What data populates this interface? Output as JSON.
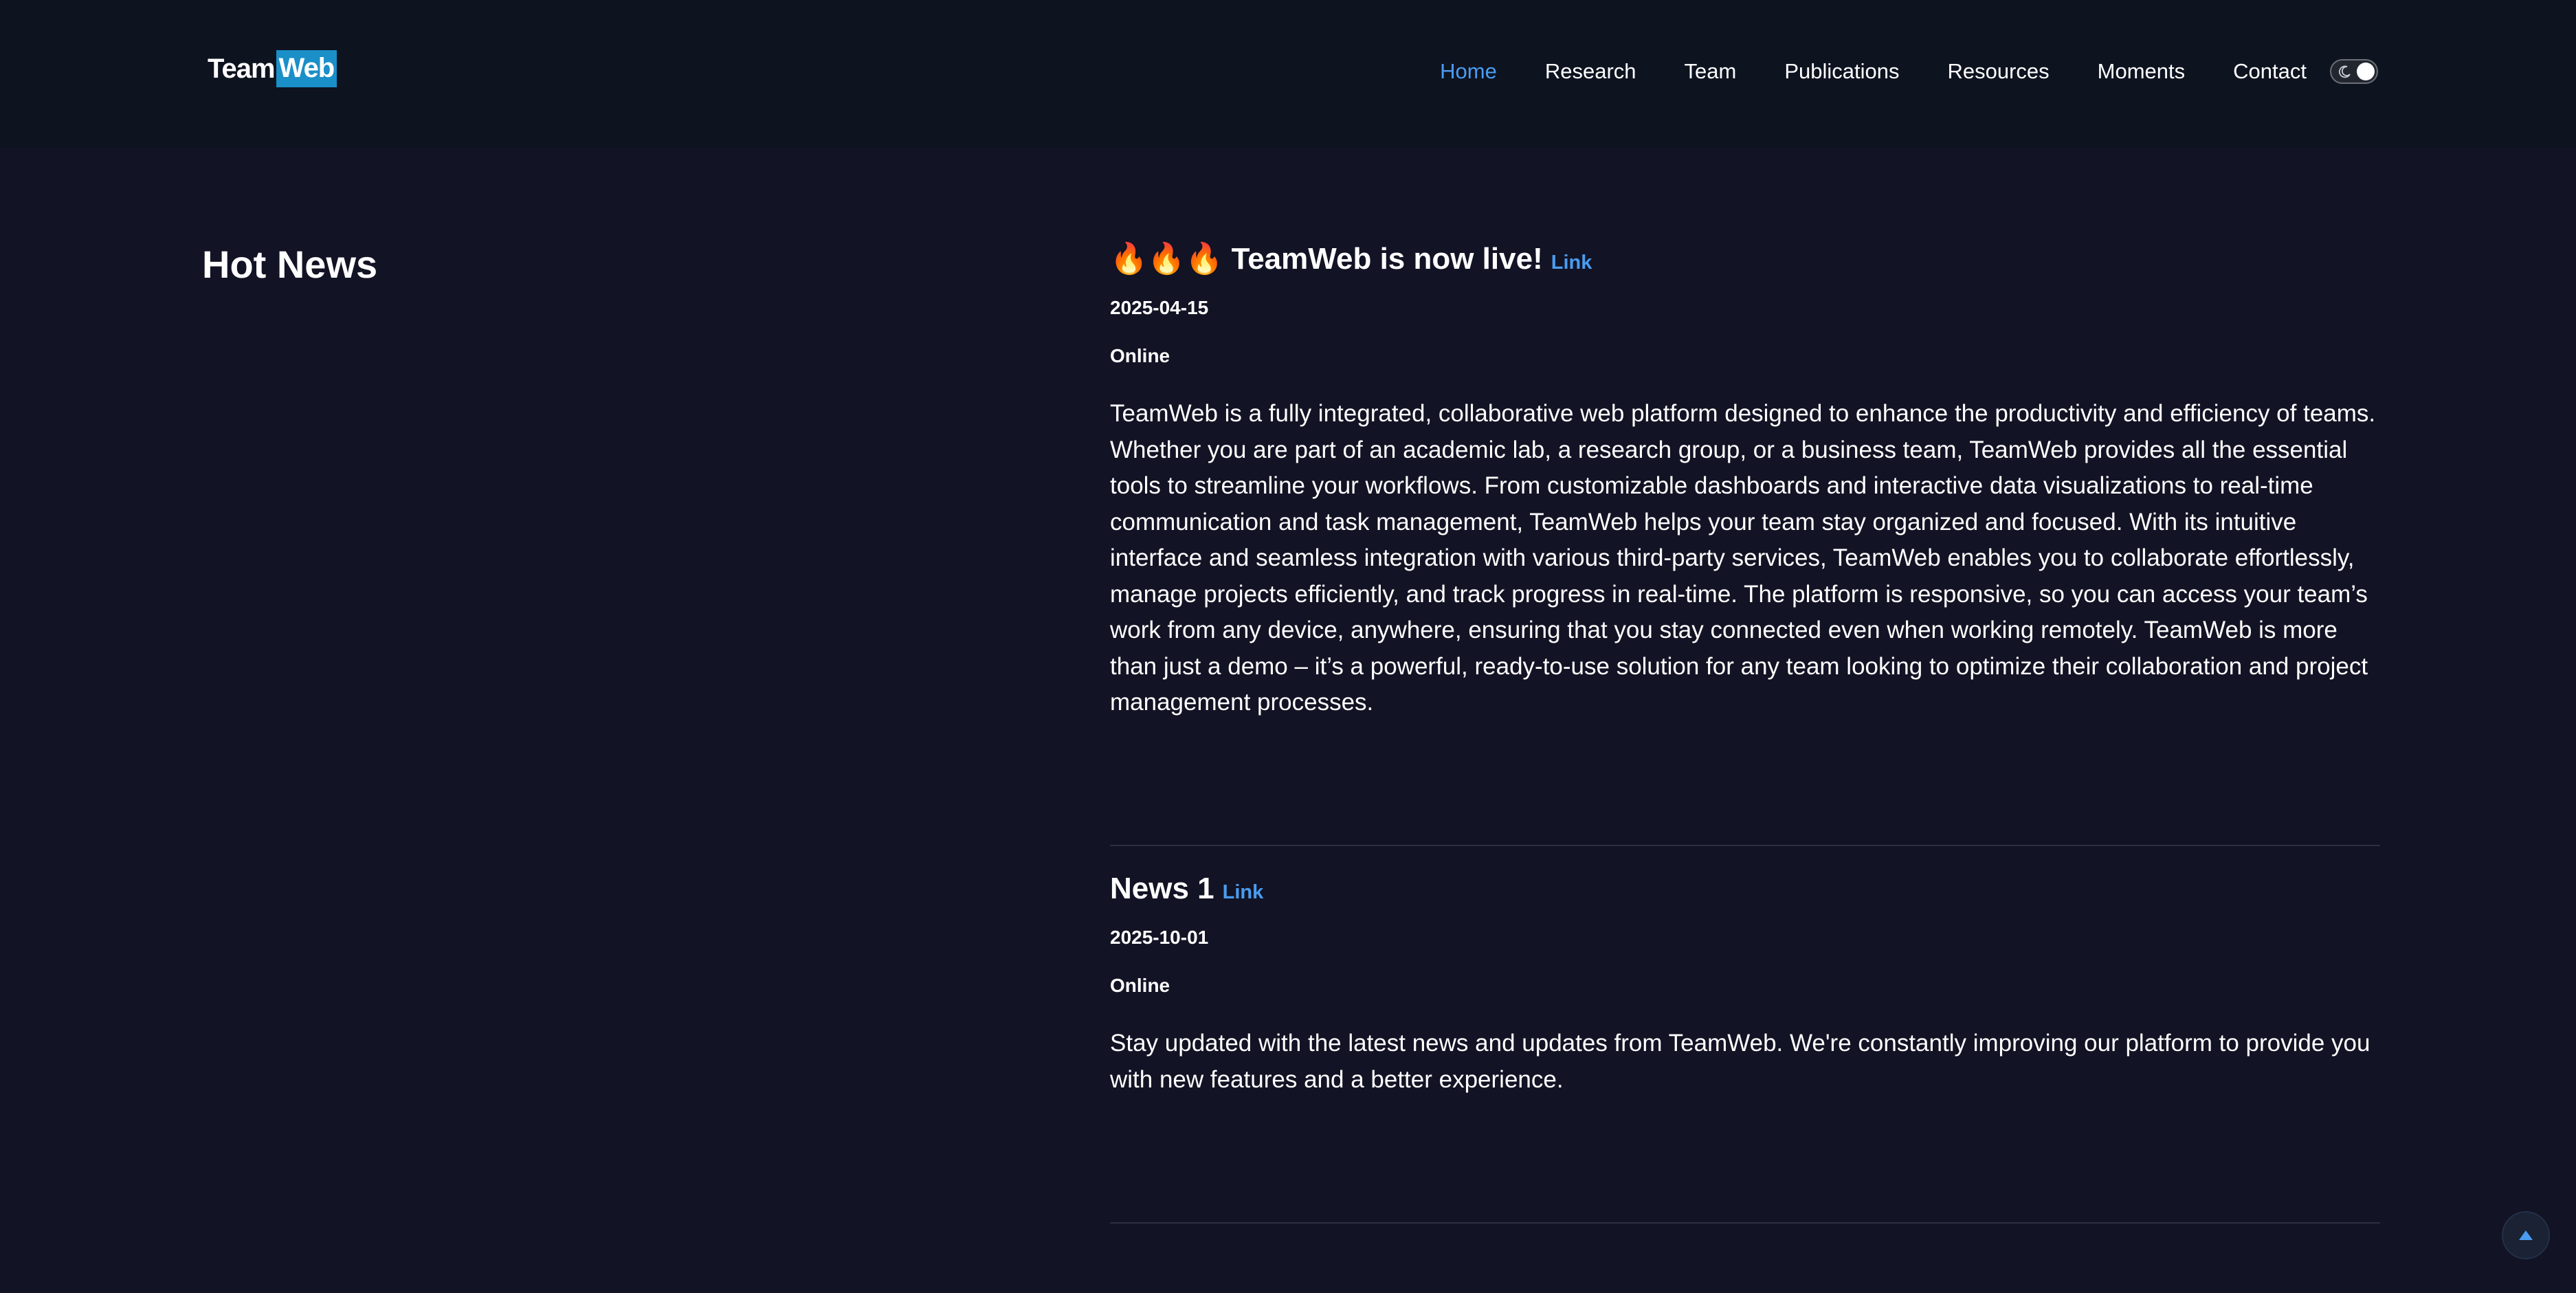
{
  "brand": {
    "name_part1": "Team",
    "name_part2": "Web",
    "accent_color": "#1a8fc8"
  },
  "nav": {
    "items": [
      {
        "label": "Home",
        "active": true
      },
      {
        "label": "Research",
        "active": false
      },
      {
        "label": "Team",
        "active": false
      },
      {
        "label": "Publications",
        "active": false
      },
      {
        "label": "Resources",
        "active": false
      },
      {
        "label": "Moments",
        "active": false
      },
      {
        "label": "Contact",
        "active": false
      }
    ],
    "active_color": "#4a9cf0",
    "theme_toggle": {
      "icon": "moon-icon",
      "dark_mode": true
    }
  },
  "section": {
    "title": "Hot News"
  },
  "news": [
    {
      "title": "🔥🔥🔥 TeamWeb is now live!",
      "link_label": "Link",
      "date": "2025-04-15",
      "venue": "Online",
      "body": "TeamWeb is a fully integrated, collaborative web platform designed to enhance the productivity and efficiency of teams. Whether you are part of an academic lab, a research group, or a business team, TeamWeb provides all the essential tools to streamline your workflows. From customizable dashboards and interactive data visualizations to real-time communication and task management, TeamWeb helps your team stay organized and focused. With its intuitive interface and seamless integration with various third-party services, TeamWeb enables you to collaborate effortlessly, manage projects efficiently, and track progress in real-time. The platform is responsive, so you can access your team’s work from any device, anywhere, ensuring that you stay connected even when working remotely. TeamWeb is more than just a demo – it’s a powerful, ready-to-use solution for any team looking to optimize their collaboration and project management processes."
    },
    {
      "title": "News 1",
      "link_label": "Link",
      "date": "2025-10-01",
      "venue": "Online",
      "body": "Stay updated with the latest news and updates from TeamWeb. We're constantly improving our platform to provide you with new features and a better experience."
    }
  ],
  "back_to_top": {
    "icon": "arrow-up-icon"
  }
}
